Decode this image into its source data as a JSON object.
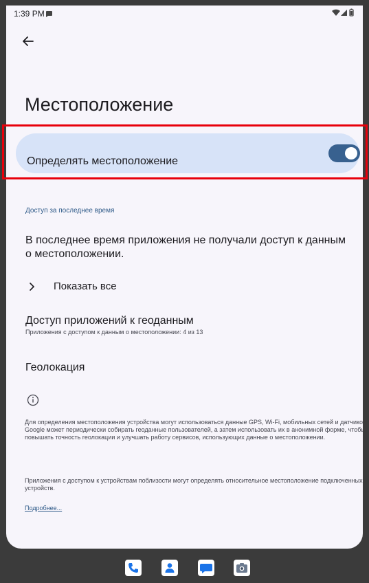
{
  "status_bar": {
    "time": "1:39 PM"
  },
  "page": {
    "title": "Местоположение"
  },
  "main_toggle": {
    "label": "Определять местоположение",
    "state": "on"
  },
  "recent": {
    "header": "Доступ за последнее время",
    "message": "В последнее время приложения не получали доступ к данным о местоположении.",
    "show_all": "Показать все"
  },
  "app_access": {
    "title": "Доступ приложений к геоданным",
    "summary": "Приложения с доступом к данным о местоположении: 4 из 13"
  },
  "geolocation": {
    "label": "Геолокация"
  },
  "footer": {
    "paragraph1": "Для определения местоположения устройства могут использоваться данные GPS, Wi-Fi, мобильных сетей и датчиков. Google может периодически собирать геоданные пользователей, а затем использовать их в анонимной форме, чтобы повышать точность геолокации и улучшать работу сервисов, использующих данные о местоположении.",
    "paragraph2": "Приложения с доступом к устройствам поблизости могут определять относительное местоположение подключенных устройств.",
    "learn_more": "Подробнее..."
  },
  "dock": {
    "apps": [
      {
        "icon": "phone-icon"
      },
      {
        "icon": "contacts-icon"
      },
      {
        "icon": "messages-icon"
      },
      {
        "icon": "camera-icon"
      }
    ]
  },
  "colors": {
    "accent": "#38618f",
    "card_background": "#d7e3f8",
    "highlight": "#e8000b",
    "link": "#2e5a88",
    "screen_background": "#f7f5fb"
  }
}
